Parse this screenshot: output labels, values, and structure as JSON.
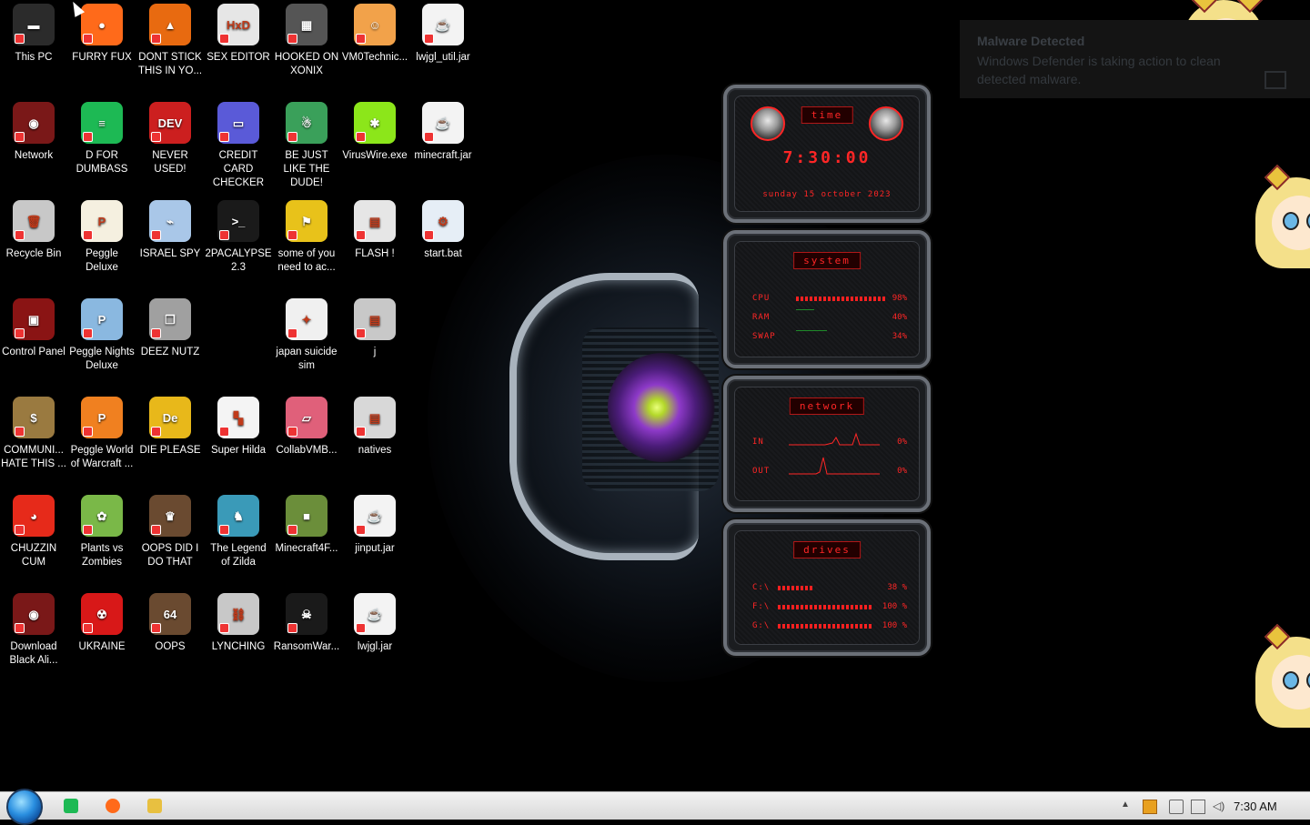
{
  "desktop": {
    "icons": [
      {
        "label": "This PC",
        "icon": "computer-icon",
        "bg": "#2b2b2b",
        "glyph": "▬"
      },
      {
        "label": "FURRY FUX",
        "icon": "firefox-icon",
        "bg": "#ff6a1a",
        "glyph": "●"
      },
      {
        "label": "DONT STICK THIS IN YO...",
        "icon": "traffic-cone-icon",
        "bg": "#e86a10",
        "glyph": "▲"
      },
      {
        "label": "SEX EDITOR",
        "icon": "hxd-editor-icon",
        "bg": "#e6e6e6",
        "glyph": "HxD"
      },
      {
        "label": "HOOKED ON XONIX",
        "icon": "xonix-game-icon",
        "bg": "#555555",
        "glyph": "▦"
      },
      {
        "label": "VM0Technic...",
        "icon": "technician-icon",
        "bg": "#f2a24a",
        "glyph": "☺"
      },
      {
        "label": "lwjgl_util.jar",
        "icon": "java-jar-icon",
        "bg": "#f3f3f3",
        "glyph": "☕"
      },
      {
        "label": "Network",
        "icon": "network-icon",
        "bg": "#7a1818",
        "glyph": "◉"
      },
      {
        "label": "D FOR DUMBASS",
        "icon": "spotify-icon",
        "bg": "#1db954",
        "glyph": "≡"
      },
      {
        "label": "NEVER USED!",
        "icon": "dev-cpp-icon",
        "bg": "#cc1f1f",
        "glyph": "DEV"
      },
      {
        "label": "CREDIT CARD CHECKER",
        "icon": "credit-card-icon",
        "bg": "#5a5ad8",
        "glyph": "▭"
      },
      {
        "label": "BE JUST LIKE THE DUDE!",
        "icon": "santa-globe-icon",
        "bg": "#3aa05a",
        "glyph": "☃"
      },
      {
        "label": "VirusWire.exe",
        "icon": "limewire-icon",
        "bg": "#8ce61a",
        "glyph": "✱"
      },
      {
        "label": "minecraft.jar",
        "icon": "java-jar-icon",
        "bg": "#f3f3f3",
        "glyph": "☕"
      },
      {
        "label": "Recycle Bin",
        "icon": "recycle-bin-icon",
        "bg": "#c8c8c8",
        "glyph": "🗑"
      },
      {
        "label": "Peggle Deluxe",
        "icon": "peggle-icon",
        "bg": "#f5f0e0",
        "glyph": "P"
      },
      {
        "label": "ISRAEL SPY",
        "icon": "spy-network-icon",
        "bg": "#a9c7e8",
        "glyph": "⌁"
      },
      {
        "label": "2PACALYPSE 2.3",
        "icon": "terminal-icon",
        "bg": "#1a1a1a",
        "glyph": ">_"
      },
      {
        "label": "some of you need to ac...",
        "icon": "dog-meme-icon",
        "bg": "#e8c21a",
        "glyph": "⚑"
      },
      {
        "label": "FLASH !",
        "icon": "winrar-icon",
        "bg": "#e6e6e6",
        "glyph": "▤"
      },
      {
        "label": "start.bat",
        "icon": "batch-file-icon",
        "bg": "#e6eef6",
        "glyph": "⚙"
      },
      {
        "label": "Control Panel",
        "icon": "control-panel-icon",
        "bg": "#8a1414",
        "glyph": "▣"
      },
      {
        "label": "Peggle Nights Deluxe",
        "icon": "peggle-icon",
        "bg": "#8ab8e0",
        "glyph": "P"
      },
      {
        "label": "DEEZ NUTZ",
        "icon": "stacked-windows-icon",
        "bg": "#a0a0a0",
        "glyph": "❐"
      },
      {
        "label": "japan suicide sim",
        "icon": "japan-file-icon",
        "bg": "#f0f0f0",
        "glyph": "✦"
      },
      {
        "label": "j",
        "icon": "winrar-icon",
        "bg": "#c8c8c8",
        "glyph": "▤"
      },
      {
        "label": "COMMUNI... HATE THIS ...",
        "icon": "money-bag-icon",
        "bg": "#9a7a40",
        "glyph": "$"
      },
      {
        "label": "Peggle World of Warcraft ...",
        "icon": "peggle-icon",
        "bg": "#f08020",
        "glyph": "P"
      },
      {
        "label": "DIE PLEASE",
        "icon": "dev-editor-icon",
        "bg": "#e8b81a",
        "glyph": "De"
      },
      {
        "label": "Super Hilda",
        "icon": "pixel-cat-icon",
        "bg": "#f4f4f4",
        "glyph": "▚"
      },
      {
        "label": "CollabVMB...",
        "icon": "collabvm-icon",
        "bg": "#e0607a",
        "glyph": "▱"
      },
      {
        "label": "natives",
        "icon": "winrar-icon",
        "bg": "#d8d8d8",
        "glyph": "▤"
      },
      {
        "label": "CHUZZIN CUM",
        "icon": "chuzzle-icon",
        "bg": "#e62a1a",
        "glyph": "◕"
      },
      {
        "label": "Plants vs Zombies",
        "icon": "plants-vs-zombies-icon",
        "bg": "#7ab848",
        "glyph": "✿"
      },
      {
        "label": "OOPS DID I DO THAT",
        "icon": "painting-icon",
        "bg": "#6a4a30",
        "glyph": "♛"
      },
      {
        "label": "The Legend of Zilda",
        "icon": "pixel-hero-icon",
        "bg": "#3a9ab8",
        "glyph": "♞"
      },
      {
        "label": "Minecraft4F...",
        "icon": "minecraft-block-icon",
        "bg": "#6b8e3a",
        "glyph": "■"
      },
      {
        "label": "jinput.jar",
        "icon": "java-jar-icon",
        "bg": "#f3f3f3",
        "glyph": "☕"
      },
      {
        "label": "Download Black Ali...",
        "icon": "download-icon",
        "bg": "#7a1818",
        "glyph": "◉"
      },
      {
        "label": "UKRAINE",
        "icon": "radiation-icon",
        "bg": "#d81818",
        "glyph": "☢"
      },
      {
        "label": "OOPS",
        "icon": "painting-64-icon",
        "bg": "#6a4a30",
        "glyph": "64"
      },
      {
        "label": "LYNCHING",
        "icon": "lynching-icon",
        "bg": "#c8c8c8",
        "glyph": "⛓"
      },
      {
        "label": "RansomWar...",
        "icon": "skull-icon",
        "bg": "#1a1a1a",
        "glyph": "☠"
      },
      {
        "label": "lwjgl.jar",
        "icon": "java-jar-icon",
        "bg": "#f3f3f3",
        "glyph": "☕"
      }
    ]
  },
  "notification": {
    "title": "Malware Detected",
    "body": "Windows Defender is taking action to clean detected malware."
  },
  "widget": {
    "time": {
      "header": "time",
      "clock": "7:30:00",
      "date": "sunday 15 october 2023"
    },
    "system": {
      "header": "system",
      "rows": [
        {
          "label": "CPU",
          "value": "98%",
          "fill": 0.98
        },
        {
          "label": "RAM",
          "value": "40%",
          "fill": 0.4
        },
        {
          "label": "SWAP",
          "value": "34%",
          "fill": 0.34
        }
      ]
    },
    "network": {
      "header": "network",
      "rows": [
        {
          "label": "IN",
          "value": "0%"
        },
        {
          "label": "OUT",
          "value": "0%"
        }
      ]
    },
    "drives": {
      "header": "drives",
      "rows": [
        {
          "label": "C:\\",
          "value": "38 %",
          "fill": 0.38
        },
        {
          "label": "F:\\",
          "value": "100 %",
          "fill": 1.0
        },
        {
          "label": "G:\\",
          "value": "100 %",
          "fill": 1.0
        }
      ]
    }
  },
  "taskbar": {
    "start_icon": "start-orb-icon",
    "pinned": [
      {
        "name": "spotify-taskbar-button",
        "icon": "spotify-icon",
        "color": "#1db954"
      },
      {
        "name": "firefox-taskbar-button",
        "icon": "firefox-icon",
        "color": "#ff6a1a"
      },
      {
        "name": "explorer-taskbar-button",
        "icon": "folder-icon",
        "color": "#e8c040"
      }
    ],
    "tray": [
      "chevron-up-icon",
      "orange-app-icon",
      "action-center-icon",
      "network-icon",
      "volume-icon"
    ],
    "clock": "7:30 AM"
  }
}
